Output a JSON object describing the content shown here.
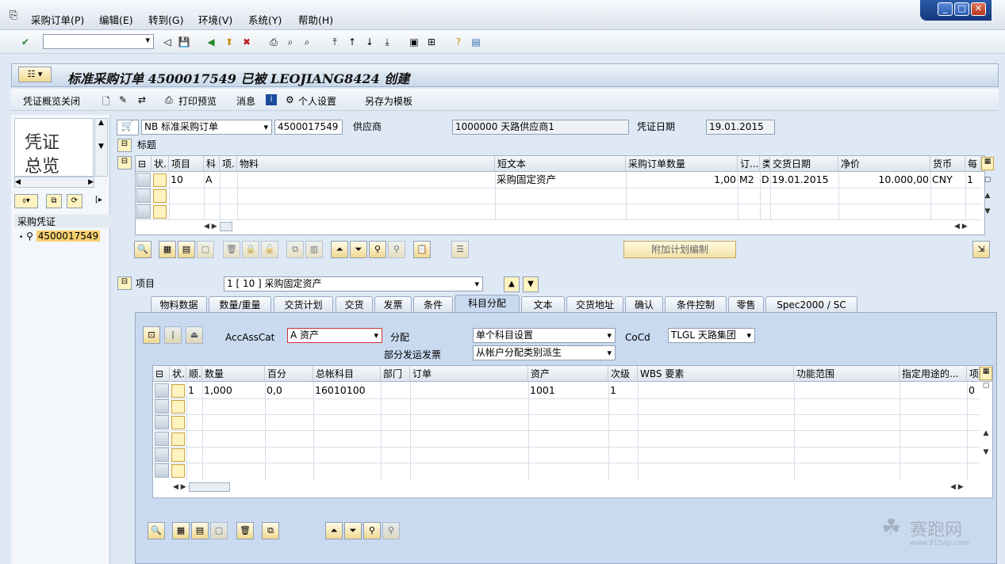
{
  "menu": {
    "items": [
      "采购订单(P)",
      "编辑(E)",
      "转到(G)",
      "环境(V)",
      "系统(Y)",
      "帮助(H)"
    ]
  },
  "window_controls": {
    "minimize": "_",
    "restore": "□",
    "close": "✕"
  },
  "title": "标准采购订单 4500017549 已被 LEOJIANG8424 创建",
  "app_toolbar": {
    "overview_close": "凭证概览关闭",
    "print_preview": "打印预览",
    "messages": "消息",
    "personal_settings": "个人设置",
    "save_as_template": "另存为模板"
  },
  "left_pane": {
    "big_label_1": "凭证",
    "big_label_2": "总览",
    "tree_header": "采购凭证",
    "tree_item": "4500017549"
  },
  "header": {
    "doc_type": "NB 标准采购订单",
    "po_number": "4500017549",
    "vendor_label": "供应商",
    "vendor_value": "1000000 天路供应商1",
    "doc_date_label": "凭证日期",
    "doc_date_value": "19.01.2015",
    "header_label": "标题"
  },
  "items_grid": {
    "columns": [
      "状.",
      "项目",
      "科",
      "项.",
      "物料",
      "短文本",
      "采购订单数量",
      "订...",
      "类",
      "交货日期",
      "净价",
      "货币",
      "每"
    ],
    "rows": [
      {
        "item": "10",
        "acct": "A",
        "short_text": "采购固定资产",
        "qty": "1,00",
        "unit": "M2",
        "cat": "D",
        "delivery_date": "19.01.2015",
        "net_price": "10.000,00",
        "currency": "CNY",
        "per": "1"
      }
    ]
  },
  "schedule_button": "附加计划编制",
  "item_section": {
    "label": "项目",
    "selected": "1 [ 10 ] 采购固定资产"
  },
  "tabs": [
    "物料数据",
    "数量/重量",
    "交货计划",
    "交货",
    "发票",
    "条件",
    "科目分配",
    "文本",
    "交货地址",
    "确认",
    "条件控制",
    "零售",
    "Spec2000 / SC"
  ],
  "account_assignment": {
    "acc_cat_label": "AccAssCat",
    "acc_cat_value": "A 资产",
    "distribution_label": "分配",
    "distribution_value": "单个科目设置",
    "partial_invoice_label": "部分发运发票",
    "partial_invoice_value": "从帐户分配类别派生",
    "coco_label": "CoCd",
    "coco_value": "TLGL 天路集团"
  },
  "acct_grid": {
    "columns": [
      "状.",
      "顺.",
      "数量",
      "百分",
      "总帐科目",
      "部门",
      "订单",
      "资产",
      "次级",
      "WBS 要素",
      "功能范围",
      "指定用途的...",
      "项"
    ],
    "rows": [
      {
        "seq": "1",
        "qty": "1,000",
        "pct": "0,0",
        "gl": "16010100",
        "asset": "1001",
        "sub": "1",
        "item": "0"
      }
    ]
  },
  "watermark": {
    "text": "赛跑网",
    "url": "www.915ap.com"
  }
}
